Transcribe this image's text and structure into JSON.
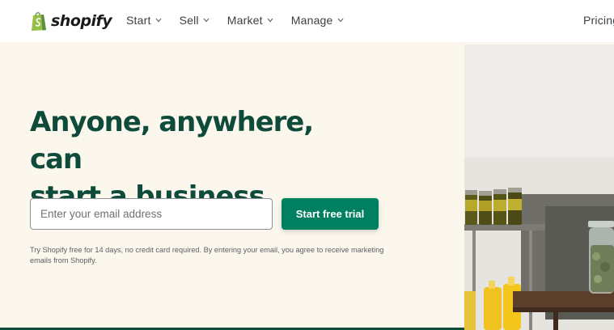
{
  "header": {
    "logo_text": "shopify",
    "nav": [
      {
        "label": "Start"
      },
      {
        "label": "Sell"
      },
      {
        "label": "Market"
      },
      {
        "label": "Manage"
      }
    ],
    "pricing_label": "Pricing"
  },
  "hero": {
    "title_line1": "Anyone, anywhere, can",
    "title_line2": "start a business",
    "email_placeholder": "Enter your email address",
    "cta_label": "Start free trial",
    "disclaimer": "Try Shopify free for 14 days, no credit card required. By entering your email, you agree to receive marketing emails from Shopify."
  },
  "colors": {
    "brand_green": "#008060",
    "heading_green": "#0e4b3b",
    "background": "#fbf7ed",
    "logo_bag": "#95bf47"
  },
  "icons": {
    "logo": "shopping-bag-icon",
    "nav_dropdown": "chevron-down-icon"
  }
}
